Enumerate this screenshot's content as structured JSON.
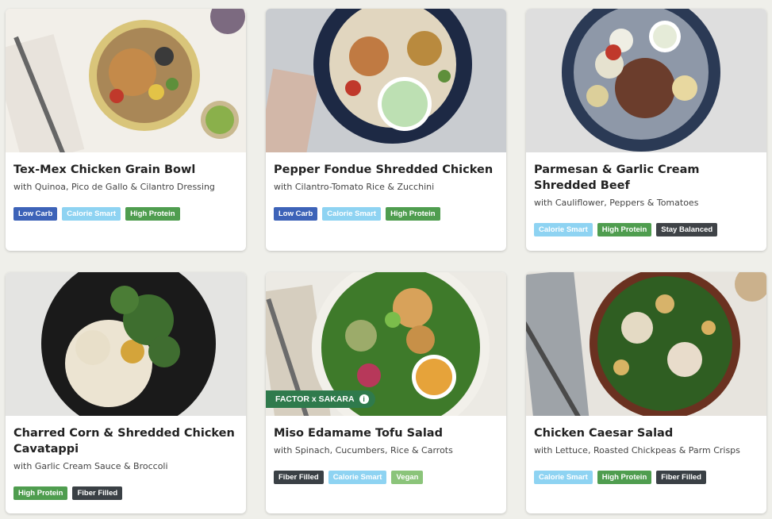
{
  "meals": [
    {
      "title": "Tex-Mex Chicken Grain Bowl",
      "subtitle": "with Quinoa, Pico de Gallo & Cilantro Dressing",
      "badges": [
        {
          "label": "Low Carb",
          "color": "#3d63b8"
        },
        {
          "label": "Calorie Smart",
          "color": "#8ed3f2"
        },
        {
          "label": "High Protein",
          "color": "#4f9d4f"
        }
      ]
    },
    {
      "title": "Pepper Fondue Shredded Chicken",
      "subtitle": "with Cilantro-Tomato Rice & Zucchini",
      "badges": [
        {
          "label": "Low Carb",
          "color": "#3d63b8"
        },
        {
          "label": "Calorie Smart",
          "color": "#8ed3f2"
        },
        {
          "label": "High Protein",
          "color": "#4f9d4f"
        }
      ]
    },
    {
      "title": "Parmesan & Garlic Cream Shredded Beef",
      "subtitle": "with Cauliflower, Peppers & Tomatoes",
      "badges": [
        {
          "label": "Calorie Smart",
          "color": "#8ed3f2"
        },
        {
          "label": "High Protein",
          "color": "#4f9d4f"
        },
        {
          "label": "Stay Balanced",
          "color": "#3f4347"
        }
      ]
    },
    {
      "title": "Charred Corn & Shredded Chicken Cavatappi",
      "subtitle": "with Garlic Cream Sauce & Broccoli",
      "badges": [
        {
          "label": "High Protein",
          "color": "#4f9d4f"
        },
        {
          "label": "Fiber Filled",
          "color": "#3a4045"
        }
      ]
    },
    {
      "title": "Miso Edamame Tofu Salad",
      "subtitle": "with Spinach, Cucumbers, Rice & Carrots",
      "partner_label": "FACTOR x SAKARA",
      "badges": [
        {
          "label": "Fiber Filled",
          "color": "#3a4045"
        },
        {
          "label": "Calorie Smart",
          "color": "#8ed3f2"
        },
        {
          "label": "Vegan",
          "color": "#8bc47a"
        }
      ]
    },
    {
      "title": "Chicken Caesar Salad",
      "subtitle": "with Lettuce, Roasted Chickpeas & Parm Crisps",
      "badges": [
        {
          "label": "Calorie Smart",
          "color": "#8ed3f2"
        },
        {
          "label": "High Protein",
          "color": "#4f9d4f"
        },
        {
          "label": "Fiber Filled",
          "color": "#3a4045"
        }
      ]
    }
  ]
}
